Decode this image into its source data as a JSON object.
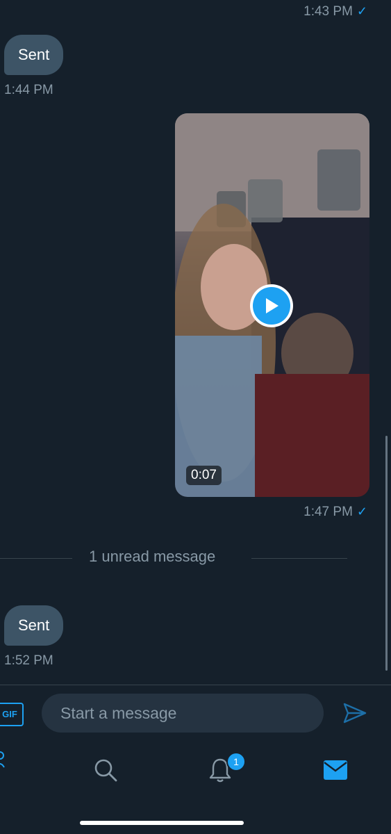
{
  "messages": [
    {
      "timestamp": "1:43 PM",
      "read_check": "✓"
    },
    {
      "bubble_text": "Sent",
      "timestamp": "1:44 PM"
    },
    {
      "video_duration": "0:07",
      "timestamp": "1:47 PM",
      "read_check": "✓"
    },
    {
      "bubble_text": "Sent",
      "timestamp": "1:52 PM"
    }
  ],
  "unread_divider": "1 unread message",
  "composer": {
    "gif_label": "GIF",
    "placeholder": "Start a message"
  },
  "tabbar": {
    "icons": [
      "search-icon",
      "bell-icon",
      "mail-icon"
    ],
    "notification_count": "1"
  },
  "colors": {
    "background": "#15202b",
    "bubble": "#3d5466",
    "accent": "#1da1f2",
    "muted_text": "#8899a6"
  }
}
